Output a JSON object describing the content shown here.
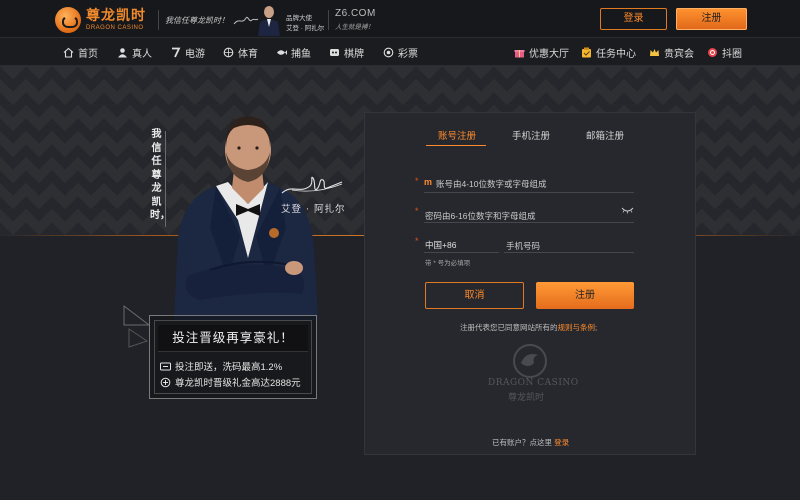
{
  "header": {
    "logo_cn": "尊龙凯时",
    "logo_en": "DRAGON CASINO",
    "slogan": "我信任尊龙凯时！",
    "ambassador_title": "品牌大使",
    "ambassador_name": "艾登 · 阿扎尔",
    "domain": "Z6.COM",
    "domain_sub": "人生就是搏！",
    "login_label": "登录",
    "register_label": "注册"
  },
  "nav": {
    "left": [
      {
        "label": "首页",
        "icon": "home-icon"
      },
      {
        "label": "真人",
        "icon": "user-icon"
      },
      {
        "label": "电游",
        "icon": "seven-icon"
      },
      {
        "label": "体育",
        "icon": "sports-icon"
      },
      {
        "label": "捕鱼",
        "icon": "fish-icon"
      },
      {
        "label": "棋牌",
        "icon": "cards-icon"
      },
      {
        "label": "彩票",
        "icon": "lottery-icon"
      }
    ],
    "right": [
      {
        "label": "优惠大厅",
        "icon": "gift-icon"
      },
      {
        "label": "任务中心",
        "icon": "task-icon"
      },
      {
        "label": "贵宾会",
        "icon": "crown-icon"
      },
      {
        "label": "抖圈",
        "icon": "douyin-icon"
      }
    ]
  },
  "hero": {
    "vertical_slogan": "我信任尊龙凯时，",
    "player_name": "艾登 · 阿扎尔",
    "promo_title": "投注晋级再享豪礼！",
    "promo_line1": "投注即送，洗码最高1.2%",
    "promo_line2": "尊龙凯时晋级礼金高达2888元"
  },
  "form": {
    "tabs": [
      "账号注册",
      "手机注册",
      "邮箱注册"
    ],
    "active_tab": 0,
    "account_placeholder": "账号由4-10位数字或字母组成",
    "password_placeholder": "密码由6-16位数字和字母组成",
    "country_code": "中国+86",
    "phone_placeholder": "手机号码",
    "required_hint": "带 * 号为必填项",
    "cancel_label": "取消",
    "submit_label": "注册",
    "agree_text": "注册代表您已同意网站所有的",
    "agree_link": "规则与条例",
    "agree_end": ";",
    "watermark_en": "DRAGON CASINO",
    "watermark_cn": "尊龙凯时",
    "has_account": "已有账户？点这里",
    "login_link": "登录"
  },
  "colors": {
    "accent": "#ff8b2e",
    "background": "#1f2126",
    "panel": "#26282d",
    "required": "#e0521c"
  }
}
